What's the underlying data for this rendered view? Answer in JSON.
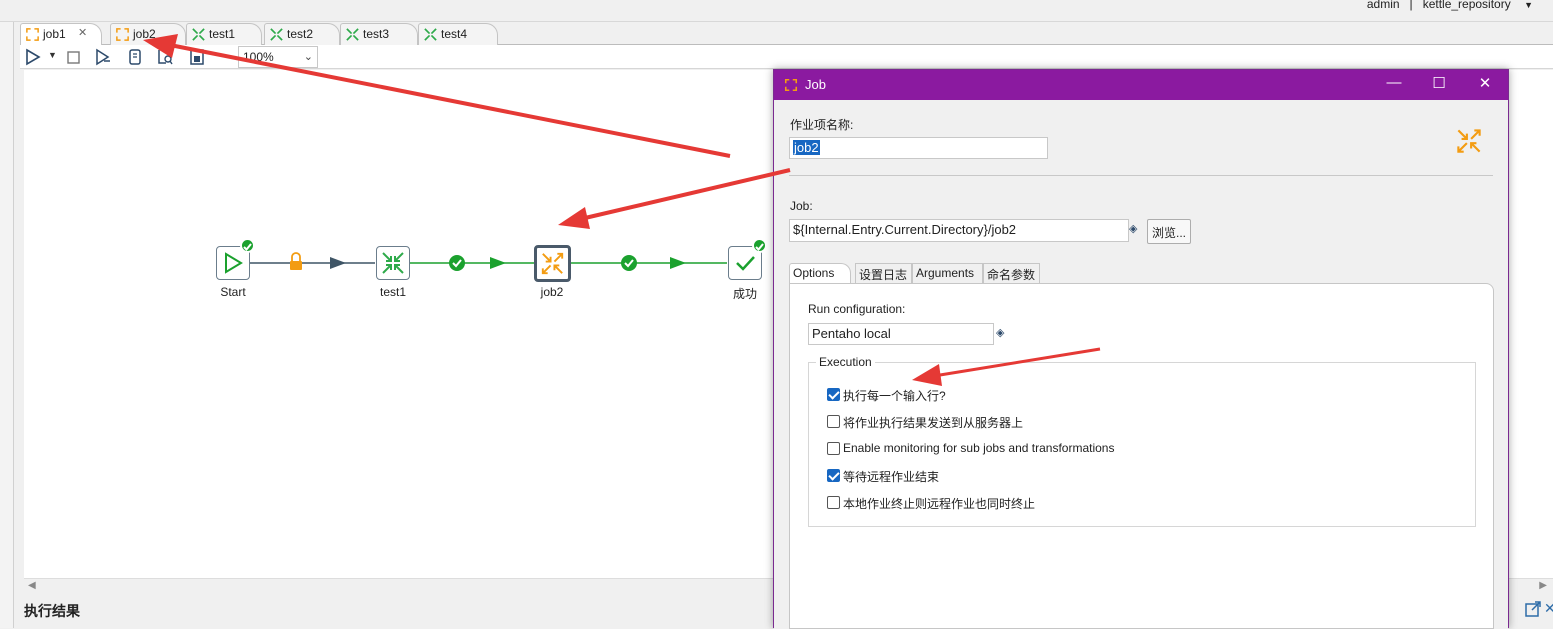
{
  "header": {
    "user": "admin",
    "separator": "|",
    "repository": "kettle_repository"
  },
  "tabs": [
    {
      "label": "job1",
      "type": "job",
      "closable": true
    },
    {
      "label": "job2",
      "type": "job"
    },
    {
      "label": "test1",
      "type": "transformation"
    },
    {
      "label": "test2",
      "type": "transformation"
    },
    {
      "label": "test3",
      "type": "transformation"
    },
    {
      "label": "test4",
      "type": "transformation"
    }
  ],
  "toolbar": {
    "zoom": "100%"
  },
  "canvas": {
    "nodes": [
      {
        "label": "Start",
        "icon": "play-icon",
        "status": "success"
      },
      {
        "label": "test1",
        "icon": "transformation-icon",
        "status": "success"
      },
      {
        "label": "job2",
        "icon": "job-icon",
        "status": "none",
        "selected": true
      },
      {
        "label": "成功",
        "icon": "check-icon",
        "status": "success"
      }
    ],
    "hops": [
      {
        "from": "Start",
        "to": "test1",
        "type": "unconditional",
        "color": "#3f5566"
      },
      {
        "from": "test1",
        "to": "job2",
        "type": "success",
        "color": "#1ba12e"
      },
      {
        "from": "job2",
        "to": "成功",
        "type": "success",
        "color": "#1ba12e"
      }
    ]
  },
  "bottom": {
    "results_title": "执行结果"
  },
  "dialog": {
    "title": "Job",
    "entry_name_label": "作业项名称:",
    "entry_name_value": "job2",
    "job_label": "Job:",
    "job_path": "${Internal.Entry.Current.Directory}/job2",
    "browse_button": "浏览...",
    "tabs": [
      "Options",
      "设置日志",
      "Arguments",
      "命名参数"
    ],
    "active_tab": "Options",
    "run_config_label": "Run configuration:",
    "run_config_value": "Pentaho local",
    "execution_legend": "Execution",
    "checkboxes": [
      {
        "label": "执行每一个输入行?",
        "checked": true
      },
      {
        "label": "将作业执行结果发送到从服务器上",
        "checked": false
      },
      {
        "label": "Enable monitoring for sub jobs and transformations",
        "checked": false
      },
      {
        "label": "等待远程作业结束",
        "checked": true
      },
      {
        "label": "本地作业终止则远程作业也同时终止",
        "checked": false
      }
    ]
  },
  "colors": {
    "dialog_title": "#8b1aa0",
    "success": "#1ba12e",
    "job_icon": "#f39c12",
    "trans_icon": "#2eaa4a",
    "annotation_arrow": "#e53935"
  }
}
